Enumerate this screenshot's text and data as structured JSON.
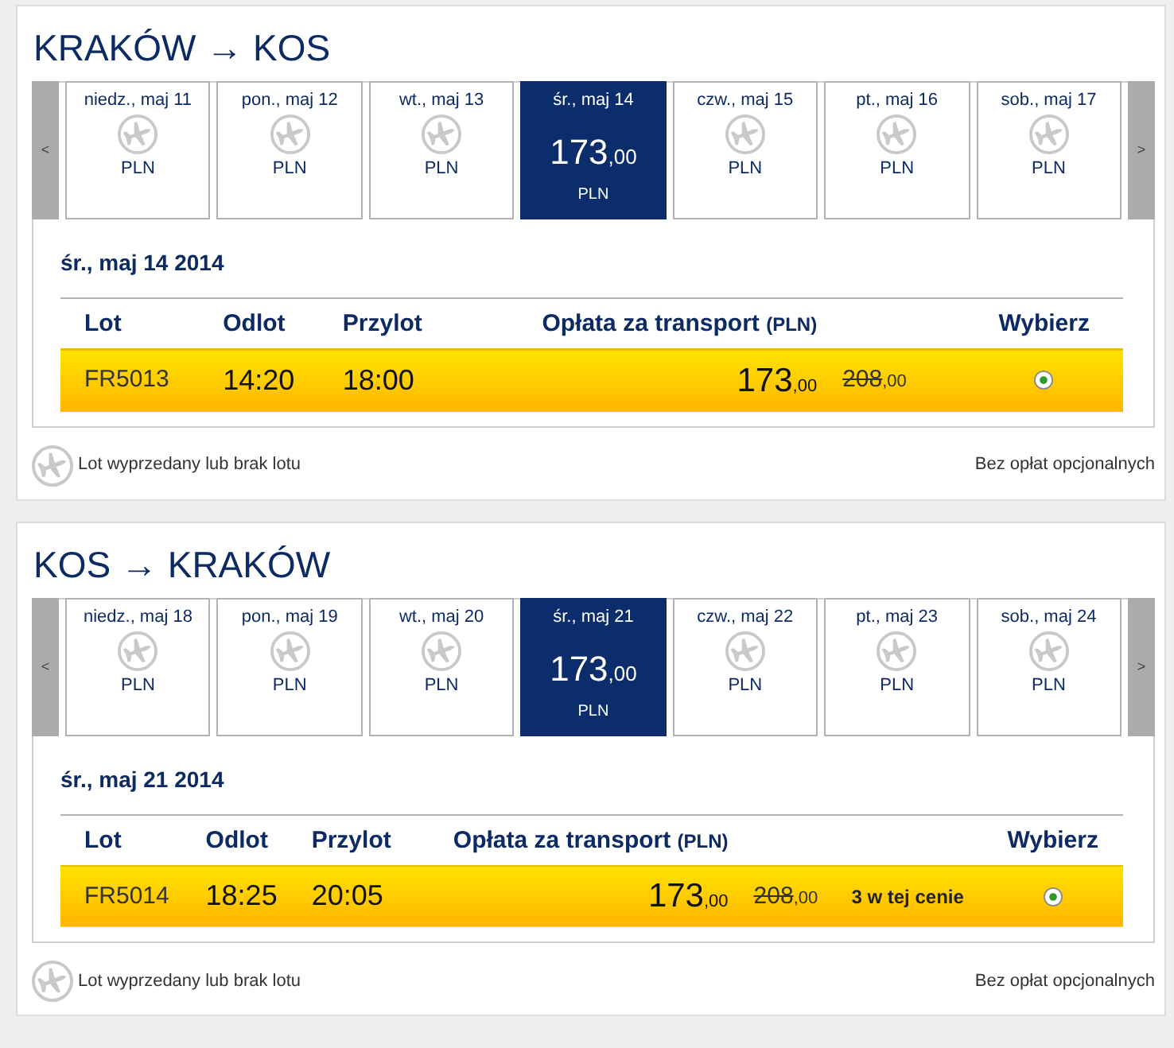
{
  "sections": [
    {
      "title": "KRAKÓW → KOS",
      "prev_button": "<",
      "next_button": ">",
      "days": [
        {
          "date": "niedz., maj 11",
          "kind": "no_flight",
          "currency": "PLN",
          "selected": false
        },
        {
          "date": "pon., maj 12",
          "kind": "no_flight",
          "currency": "PLN",
          "selected": false
        },
        {
          "date": "wt., maj 13",
          "kind": "no_flight",
          "currency": "PLN",
          "selected": false
        },
        {
          "date": "śr., maj 14",
          "kind": "fare",
          "price": "173",
          "price_decimals": ",00",
          "currency": "PLN",
          "selected": true
        },
        {
          "date": "czw., maj 15",
          "kind": "no_flight",
          "currency": "PLN",
          "selected": false
        },
        {
          "date": "pt., maj 16",
          "kind": "no_flight",
          "currency": "PLN",
          "selected": false
        },
        {
          "date": "sob., maj 17",
          "kind": "no_flight",
          "currency": "PLN",
          "selected": false
        }
      ],
      "date_heading": "śr., maj 14 2014",
      "columns": [
        {
          "label": "Lot"
        },
        {
          "label": "Odlot"
        },
        {
          "label": "Przylot"
        },
        {
          "label": "Opłata za transport",
          "unit": "(PLN)"
        },
        {
          "label": "Wybierz"
        }
      ],
      "flights": [
        {
          "number": "FR5013",
          "departure": "14:20",
          "arrival": "18:00",
          "price": "173",
          "price_decimals": ",00",
          "old_price": "208",
          "old_price_decimals": ",00",
          "selected": true
        }
      ],
      "legend": "Lot wyprzedany lub brak lotu",
      "note": "Bez opłat opcjonalnych"
    },
    {
      "title": "KOS → KRAKÓW",
      "prev_button": "<",
      "next_button": ">",
      "days": [
        {
          "date": "niedz., maj 18",
          "kind": "no_flight",
          "currency": "PLN",
          "selected": false
        },
        {
          "date": "pon., maj 19",
          "kind": "no_flight",
          "currency": "PLN",
          "selected": false
        },
        {
          "date": "wt., maj 20",
          "kind": "no_flight",
          "currency": "PLN",
          "selected": false
        },
        {
          "date": "śr., maj 21",
          "kind": "fare",
          "price": "173",
          "price_decimals": ",00",
          "currency": "PLN",
          "selected": true
        },
        {
          "date": "czw., maj 22",
          "kind": "no_flight",
          "currency": "PLN",
          "selected": false
        },
        {
          "date": "pt., maj 23",
          "kind": "no_flight",
          "currency": "PLN",
          "selected": false
        },
        {
          "date": "sob., maj 24",
          "kind": "no_flight",
          "currency": "PLN",
          "selected": false
        }
      ],
      "date_heading": "śr., maj 21 2014",
      "columns": [
        {
          "label": "Lot"
        },
        {
          "label": "Odlot"
        },
        {
          "label": "Przylot"
        },
        {
          "label": "Opłata za transport",
          "unit": "(PLN)"
        },
        {
          "label": "Wybierz"
        }
      ],
      "flights": [
        {
          "number": "FR5014",
          "departure": "18:25",
          "arrival": "20:05",
          "price": "173",
          "price_decimals": ",00",
          "old_price": "208",
          "old_price_decimals": ",00",
          "seats_note": "3 w tej cenie",
          "selected": true
        }
      ],
      "legend": "Lot wyprzedany lub brak lotu",
      "note": "Bez opłat opcjonalnych"
    }
  ]
}
